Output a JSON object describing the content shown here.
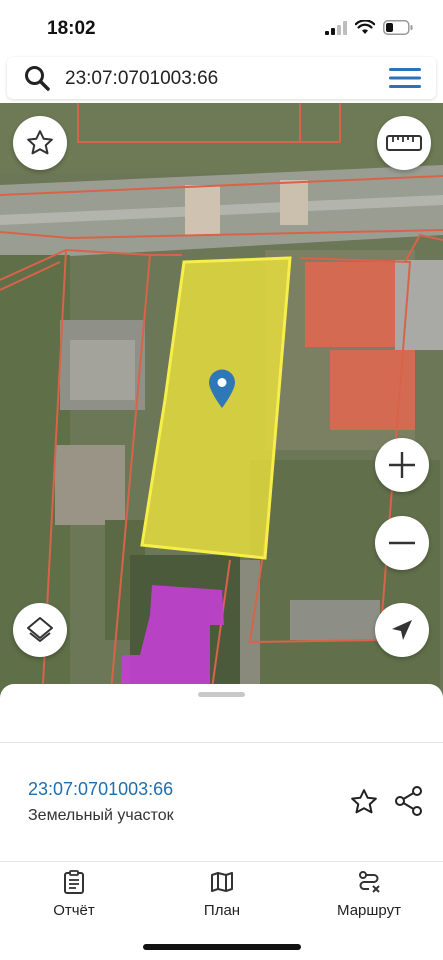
{
  "status_bar": {
    "time": "18:02"
  },
  "search": {
    "query": "23:07:0701003:66"
  },
  "parcel": {
    "id": "23:07:0701003:66",
    "type": "Земельный участок"
  },
  "nav": {
    "items": [
      {
        "label": "Отчёт",
        "icon": "report-icon"
      },
      {
        "label": "План",
        "icon": "map-icon"
      },
      {
        "label": "Маршрут",
        "icon": "route-icon"
      }
    ]
  },
  "colors": {
    "accent_blue": "#1f6fae",
    "parcel_fill": "#f0e53b",
    "boundary": "#d9634a",
    "neighbor_fill": "#c33fd1",
    "marker": "#2f78b8"
  }
}
